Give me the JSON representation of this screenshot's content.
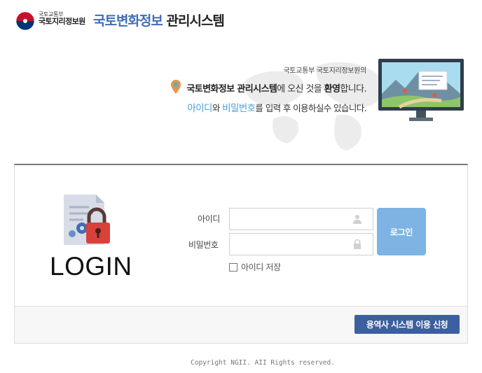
{
  "header": {
    "org_parent": "국토교통부",
    "org_name": "국토지리정보원",
    "brand_highlight": "국토변화정보",
    "brand_rest": "관리시스템"
  },
  "welcome": {
    "line1": "국토교통부 국토지리정보원의",
    "line2_bold": "국토변화정보 관리시스템",
    "line2_mid": "에 오신 것을 ",
    "line2_bold2": "환영",
    "line2_end": "합니다.",
    "line3_hl1": "아이디",
    "line3_mid": "와 ",
    "line3_hl2": "비밀번호",
    "line3_end": "를 입력 후 이용하실수 있습니다."
  },
  "login": {
    "heading": "LOGIN",
    "id_label": "아이디",
    "id_value": "",
    "pw_label": "비밀번호",
    "pw_value": "",
    "login_button": "로그인",
    "save_id_label": "아이디 저장",
    "save_id_checked": false,
    "apply_button": "용역사 시스템 이용 신청"
  },
  "footer": {
    "copyright": "Copyright NGII. AII Rights reserved."
  },
  "colors": {
    "brand_blue": "#3f6db5",
    "highlight_blue": "#4a9ed9",
    "login_button": "#7eb4e3",
    "apply_button": "#3c5fa0",
    "emblem_red": "#c8102e",
    "emblem_navy": "#003478"
  },
  "icons": {
    "emblem": "government-emblem-icon",
    "pin": "map-pin-icon",
    "monitor": "monitor-map-illustration",
    "lock": "lock-document-illustration",
    "user": "user-icon",
    "password": "lock-icon"
  }
}
